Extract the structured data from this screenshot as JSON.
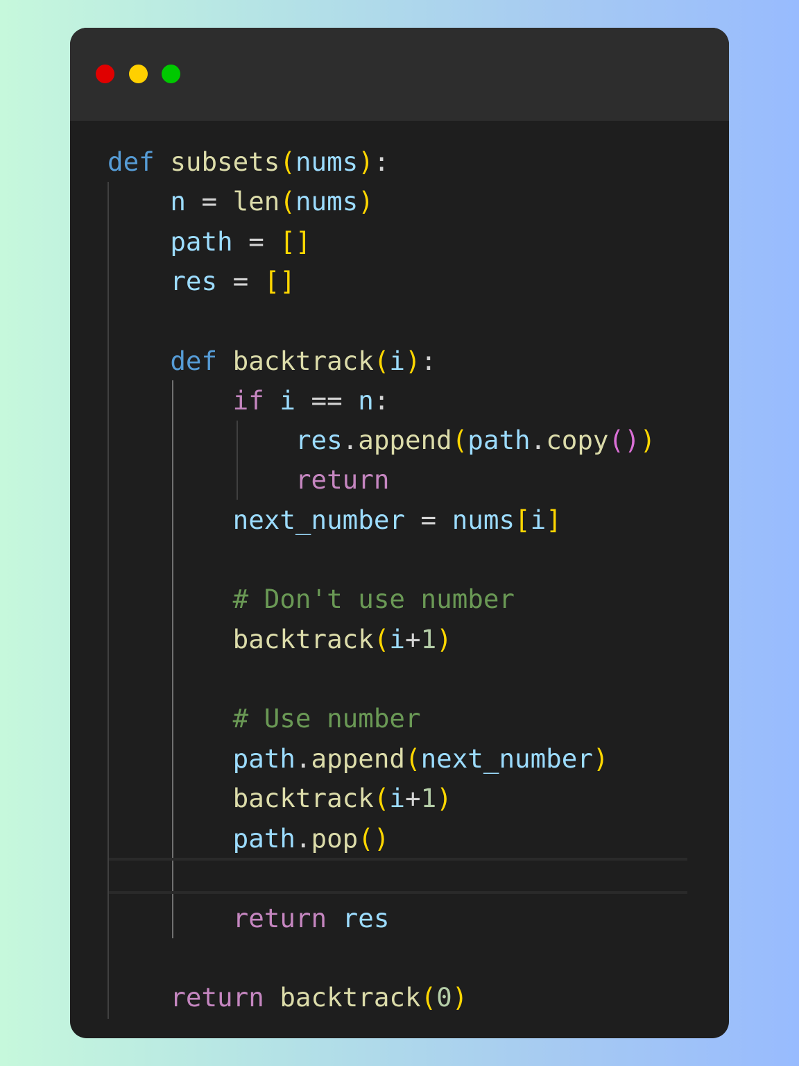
{
  "window": {
    "dots": [
      {
        "name": "close",
        "color": "#e00000"
      },
      {
        "name": "minimize",
        "color": "#ffd000"
      },
      {
        "name": "maximize",
        "color": "#00c800"
      }
    ]
  },
  "syntax_colors": {
    "keyword": "#569cd6",
    "function": "#dcdcaa",
    "variable": "#9cdcfe",
    "bracket_level_1": "#ffd700",
    "bracket_level_2": "#da70d6",
    "control": "#c586c0",
    "comment": "#6a9955",
    "number": "#b5cea8",
    "background": "#1e1e1e",
    "titlebar": "#2d2d2d"
  },
  "code": {
    "language": "python",
    "lines": [
      "def subsets(nums):",
      "    n = len(nums)",
      "    path = []",
      "    res = []",
      "",
      "    def backtrack(i):",
      "        if i == n:",
      "            res.append(path.copy())",
      "            return",
      "        next_number = nums[i]",
      "",
      "        # Don't use number",
      "        backtrack(i+1)",
      "",
      "        # Use number",
      "        path.append(next_number)",
      "        backtrack(i+1)",
      "        path.pop()",
      "",
      "        return res",
      "",
      "    return backtrack(0)"
    ],
    "tokens": {
      "def": "def",
      "subsets": "subsets",
      "nums": "nums",
      "n": "n",
      "len": "len",
      "path": "path",
      "res": "res",
      "backtrack": "backtrack",
      "i": "i",
      "if": "if",
      "append": "append",
      "copy": "copy",
      "return": "return",
      "next_number": "next_number",
      "pop": "pop",
      "comment_dont": "# Don't use number",
      "comment_use": "# Use number",
      "one": "1",
      "zero": "0"
    }
  }
}
